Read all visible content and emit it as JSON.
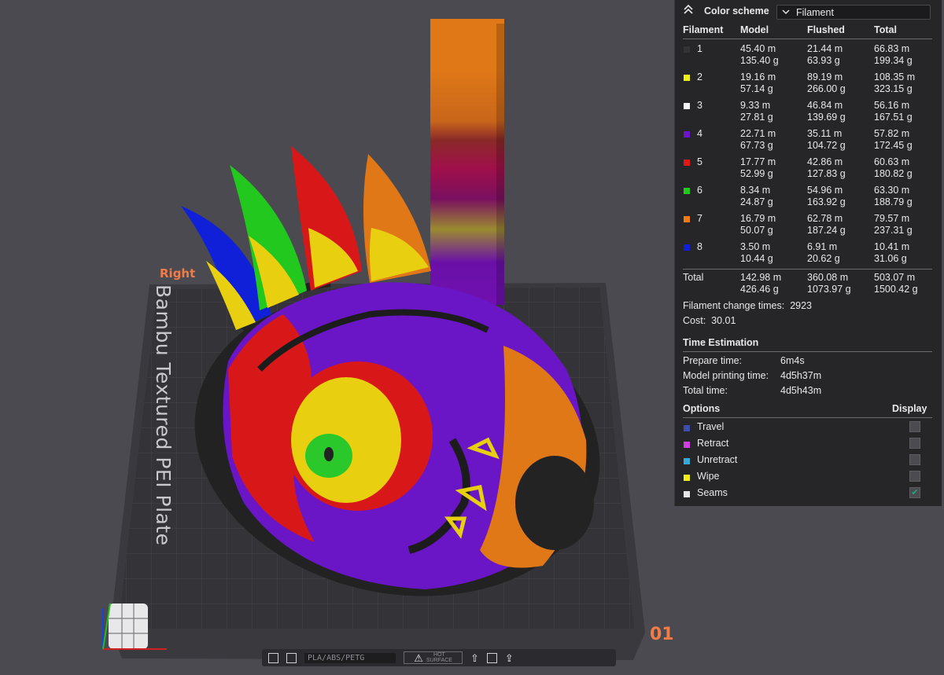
{
  "viewport": {
    "view_label": "Right",
    "plate_text": "Bambu Textured PEI Plate",
    "plate_number": "01",
    "toolbar": {
      "plate_type": "PLA/ABS/PETG",
      "surface_line1": "HOT",
      "surface_line2": "SURFACE"
    }
  },
  "legend": {
    "color_scheme_label": "Color scheme",
    "color_scheme_value": "Filament",
    "columns": {
      "filament": "Filament",
      "model": "Model",
      "flushed": "Flushed",
      "total": "Total"
    },
    "filaments": [
      {
        "index": "1",
        "color": "#333333",
        "model_m": "45.40 m",
        "model_g": "135.40 g",
        "flushed_m": "21.44 m",
        "flushed_g": "63.93 g",
        "total_m": "66.83 m",
        "total_g": "199.34 g"
      },
      {
        "index": "2",
        "color": "#f0f010",
        "model_m": "19.16 m",
        "model_g": "57.14 g",
        "flushed_m": "89.19 m",
        "flushed_g": "266.00 g",
        "total_m": "108.35 m",
        "total_g": "323.15 g"
      },
      {
        "index": "3",
        "color": "#f4f4f4",
        "model_m": "9.33 m",
        "model_g": "27.81 g",
        "flushed_m": "46.84 m",
        "flushed_g": "139.69 g",
        "total_m": "56.16 m",
        "total_g": "167.51 g"
      },
      {
        "index": "4",
        "color": "#6b16c8",
        "model_m": "22.71 m",
        "model_g": "67.73 g",
        "flushed_m": "35.11 m",
        "flushed_g": "104.72 g",
        "total_m": "57.82 m",
        "total_g": "172.45 g"
      },
      {
        "index": "5",
        "color": "#e01818",
        "model_m": "17.77 m",
        "model_g": "52.99 g",
        "flushed_m": "42.86 m",
        "flushed_g": "127.83 g",
        "total_m": "60.63 m",
        "total_g": "180.82 g"
      },
      {
        "index": "6",
        "color": "#22c81e",
        "model_m": "8.34 m",
        "model_g": "24.87 g",
        "flushed_m": "54.96 m",
        "flushed_g": "163.92 g",
        "total_m": "63.30 m",
        "total_g": "188.79 g"
      },
      {
        "index": "7",
        "color": "#ee7a10",
        "model_m": "16.79 m",
        "model_g": "50.07 g",
        "flushed_m": "62.78 m",
        "flushed_g": "187.24 g",
        "total_m": "79.57 m",
        "total_g": "237.31 g"
      },
      {
        "index": "8",
        "color": "#1020d8",
        "model_m": "3.50 m",
        "model_g": "10.44 g",
        "flushed_m": "6.91 m",
        "flushed_g": "20.62 g",
        "total_m": "10.41 m",
        "total_g": "31.06 g"
      }
    ],
    "total": {
      "label": "Total",
      "model_m": "142.98 m",
      "model_g": "426.46 g",
      "flushed_m": "360.08 m",
      "flushed_g": "1073.97 g",
      "total_m": "503.07 m",
      "total_g": "1500.42 g"
    },
    "filament_change_label": "Filament change times:",
    "filament_change_value": "2923",
    "cost_label": "Cost:",
    "cost_value": "30.01",
    "time_estimation_title": "Time Estimation",
    "times": [
      {
        "label": "Prepare time:",
        "value": "6m4s"
      },
      {
        "label": "Model printing time:",
        "value": "4d5h37m"
      },
      {
        "label": "Total time:",
        "value": "4d5h43m"
      }
    ],
    "options_title": "Options",
    "display_title": "Display",
    "options": [
      {
        "label": "Travel",
        "color": "#3c4fb0",
        "checked": false
      },
      {
        "label": "Retract",
        "color": "#d040e0",
        "checked": false
      },
      {
        "label": "Unretract",
        "color": "#38a8d8",
        "checked": false
      },
      {
        "label": "Wipe",
        "color": "#f0f010",
        "checked": false
      },
      {
        "label": "Seams",
        "color": "#e6e6e6",
        "checked": true
      }
    ],
    "check_mark": "✔"
  }
}
